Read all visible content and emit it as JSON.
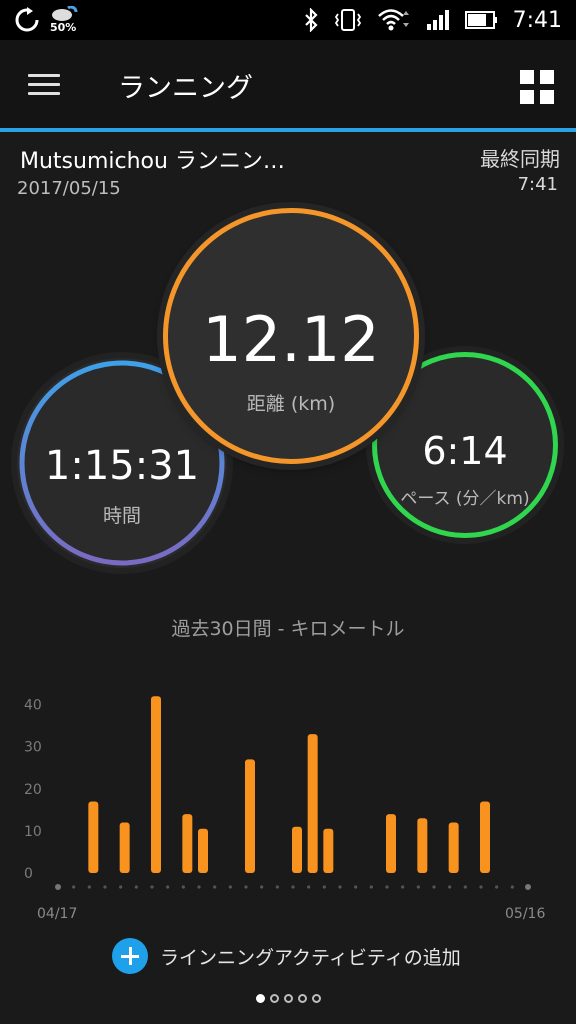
{
  "status_bar": {
    "time": "7:41",
    "weather_percent": "50%",
    "icons": [
      "sync-icon",
      "weather-icon",
      "bluetooth-icon",
      "vibrate-icon",
      "wifi-icon",
      "signal-icon",
      "battery-icon"
    ]
  },
  "toolbar": {
    "title": "ランニング",
    "menu_icon": "hamburger-menu-icon",
    "grid_icon": "grid-icon"
  },
  "activity": {
    "title": "Mutsumichou ランニン…",
    "date": "2017/05/15",
    "sync_label": "最終同期",
    "sync_time": "7:41"
  },
  "gauges": {
    "distance": {
      "value": "12.12",
      "label": "距離 (km)",
      "color": "#f5962a"
    },
    "time": {
      "value": "1:15:31",
      "label": "時間",
      "color_top": "#3ea0e8",
      "color_bottom": "#7a6ac2"
    },
    "pace": {
      "value": "6:14",
      "label": "ペース (分／km)",
      "color": "#2fd64e"
    }
  },
  "chart_title": "過去30日間 - キロメートル",
  "chart_data": {
    "type": "bar",
    "title": "過去30日間 - キロメートル",
    "xlabel": "",
    "ylabel": "",
    "ylim": [
      0,
      43
    ],
    "yticks": [
      0,
      10,
      20,
      30,
      40
    ],
    "x_start_label": "04/17",
    "x_end_label": "05/16",
    "days": 30,
    "bars": [
      {
        "day": 2,
        "value": 17
      },
      {
        "day": 4,
        "value": 12
      },
      {
        "day": 6,
        "value": 42
      },
      {
        "day": 8,
        "value": 14
      },
      {
        "day": 9,
        "value": 10.5
      },
      {
        "day": 12,
        "value": 27
      },
      {
        "day": 15,
        "value": 11
      },
      {
        "day": 16,
        "value": 33
      },
      {
        "day": 17,
        "value": 10.5
      },
      {
        "day": 21,
        "value": 14
      },
      {
        "day": 23,
        "value": 13
      },
      {
        "day": 25,
        "value": 12
      },
      {
        "day": 27,
        "value": 17
      }
    ],
    "bar_color": "#f7931e"
  },
  "add_activity": {
    "label": "ラインニングアクティビティの追加",
    "icon": "add-icon"
  },
  "pager": {
    "pages": 5,
    "active": 0
  }
}
